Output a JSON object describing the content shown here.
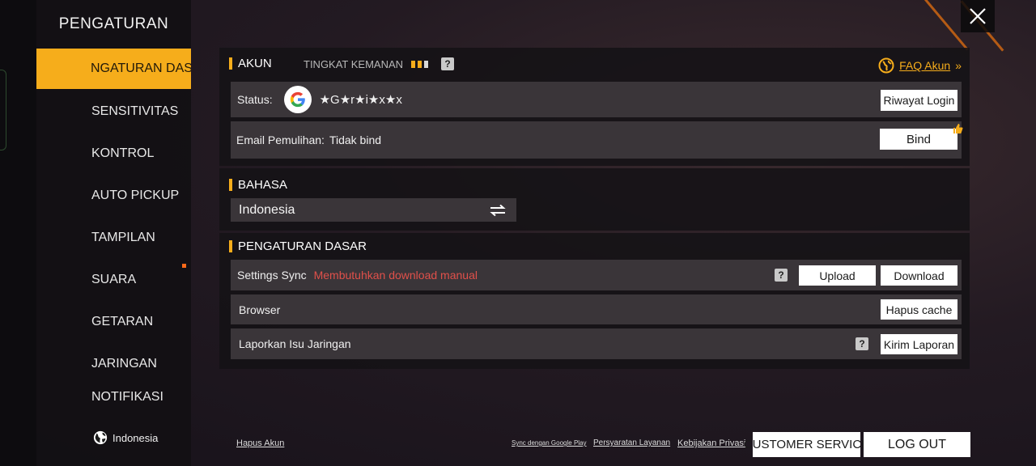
{
  "sidebar": {
    "title": "PENGATURAN",
    "items": [
      {
        "label": "NGATURAN DASA"
      },
      {
        "label": "SENSITIVITAS"
      },
      {
        "label": "KONTROL"
      },
      {
        "label": "AUTO PICKUP"
      },
      {
        "label": "TAMPILAN"
      },
      {
        "label": "SUARA"
      },
      {
        "label": "GETARAN"
      },
      {
        "label": "JARINGAN"
      },
      {
        "label": "NOTIFIKASI"
      }
    ],
    "language": "Indonesia"
  },
  "akun": {
    "title": "AKUN",
    "security_label": "TINGKAT KEMANAN",
    "security_level": {
      "filled": 2,
      "total": 3
    },
    "faq_label": "FAQ Akun",
    "status_label": "Status:",
    "username": "★G★r★i★x★x",
    "history_button": "Riwayat Login",
    "email_label": "Email Pemulihan:",
    "email_value": "Tidak bind",
    "bind_button": "Bind"
  },
  "bahasa": {
    "title": "BAHASA",
    "selected": "Indonesia"
  },
  "pengaturan": {
    "title": "PENGATURAN DASAR",
    "sync_label": "Settings Sync",
    "sync_warning": "Membutuhkan download manual",
    "upload_button": "Upload",
    "download_button": "Download",
    "browser_label": "Browser",
    "clear_cache_button": "Hapus cache",
    "report_label": "Laporkan Isu Jaringan",
    "report_button": "Kirim Laporan"
  },
  "footer": {
    "delete_account": "Hapus Akun",
    "sync_google": "Sync dengan Google Play",
    "terms": "Persyaratan Layanan",
    "privacy": "Kebijakan Privasi",
    "customer_service": "CUSTOMER SERVICE",
    "logout": "LOG OUT"
  },
  "colors": {
    "accent": "#f6ad1b",
    "warning": "#e0504a",
    "row_bg": "#3a3539"
  },
  "icons": {
    "close": "close-icon",
    "globe": "globe-icon",
    "google": "google-icon",
    "swap": "swap-icon",
    "help": "question-icon"
  }
}
